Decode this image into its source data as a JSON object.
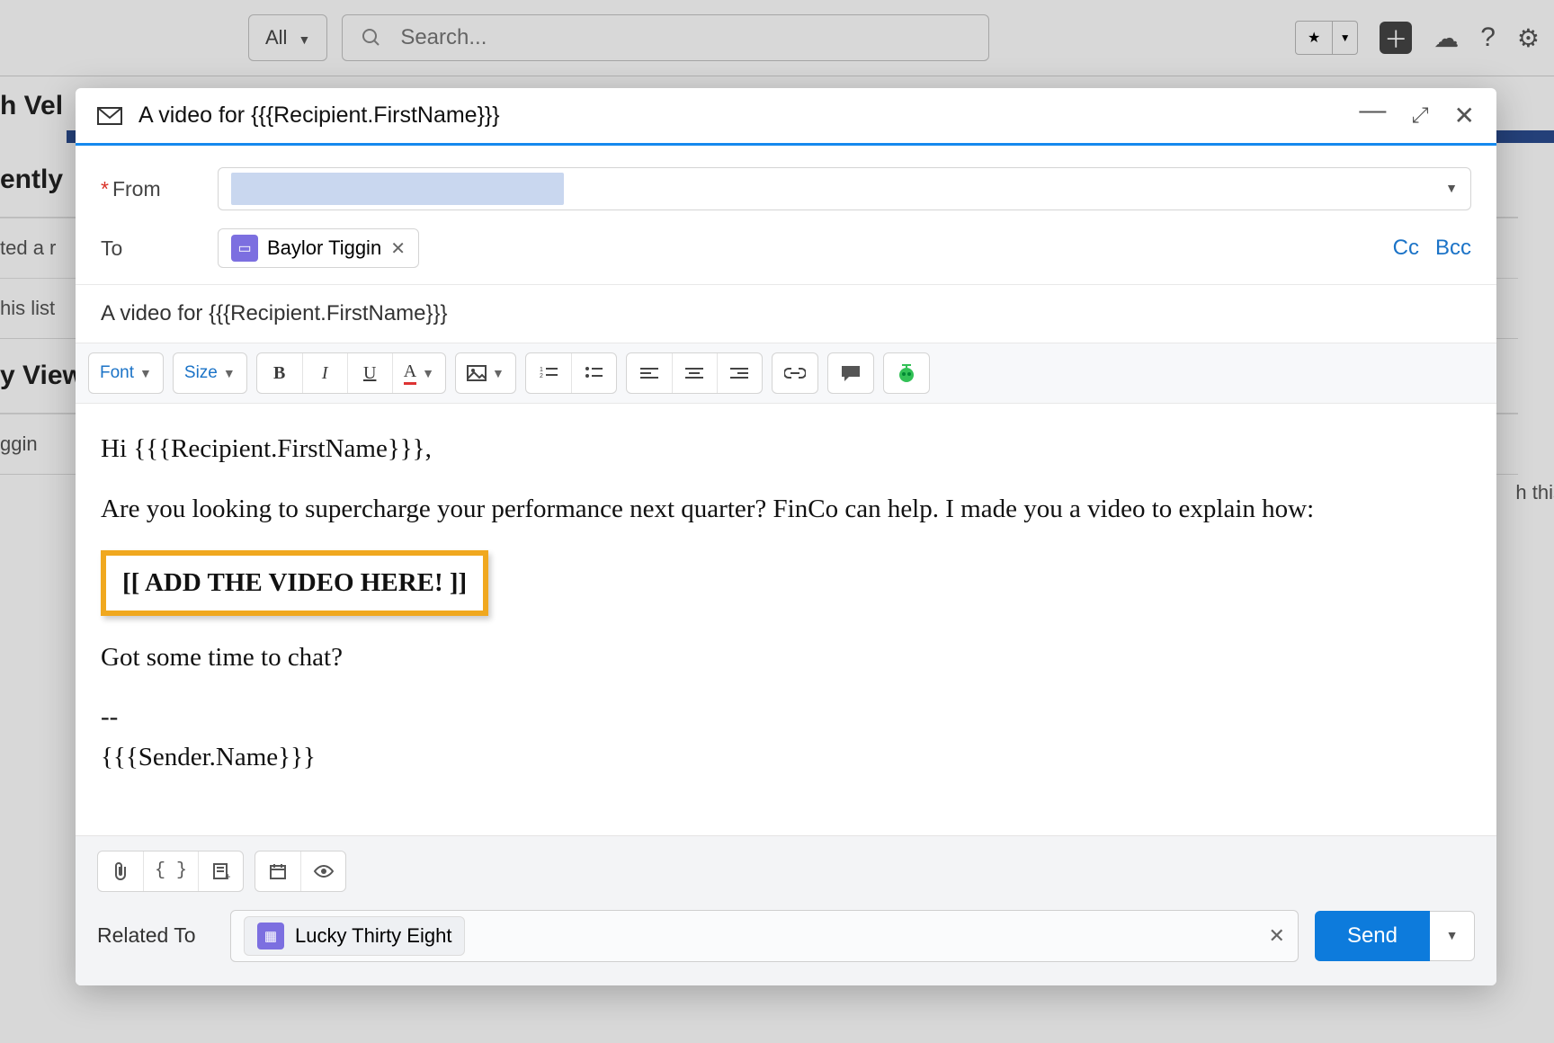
{
  "background": {
    "filter_label": "All",
    "search_placeholder": "Search...",
    "heading_left_fragment": "h Vel",
    "section1": "ently",
    "row1": "ted a r",
    "row2": "his list",
    "section2": "y View",
    "row3": "ggin",
    "right_fragment": "h this"
  },
  "compose": {
    "title": "A video for {{{Recipient.FirstName}}}",
    "from_label": "From",
    "to_label": "To",
    "to_chip": "Baylor Tiggin",
    "cc_label": "Cc",
    "bcc_label": "Bcc",
    "subject": "A video for {{{Recipient.FirstName}}}",
    "toolbar": {
      "font": "Font",
      "size": "Size"
    },
    "body": {
      "line1": "Hi {{{Recipient.FirstName}}},",
      "line2": "Are you looking to supercharge your performance next quarter? FinCo can help. I made you a video to explain how:",
      "highlight": "[[ ADD THE VIDEO HERE! ]]",
      "line3": "Got some time to chat?",
      "sig_sep": "--",
      "sig_name": "{{{Sender.Name}}}"
    },
    "related_label": "Related To",
    "related_value": "Lucky Thirty Eight",
    "send_label": "Send"
  }
}
